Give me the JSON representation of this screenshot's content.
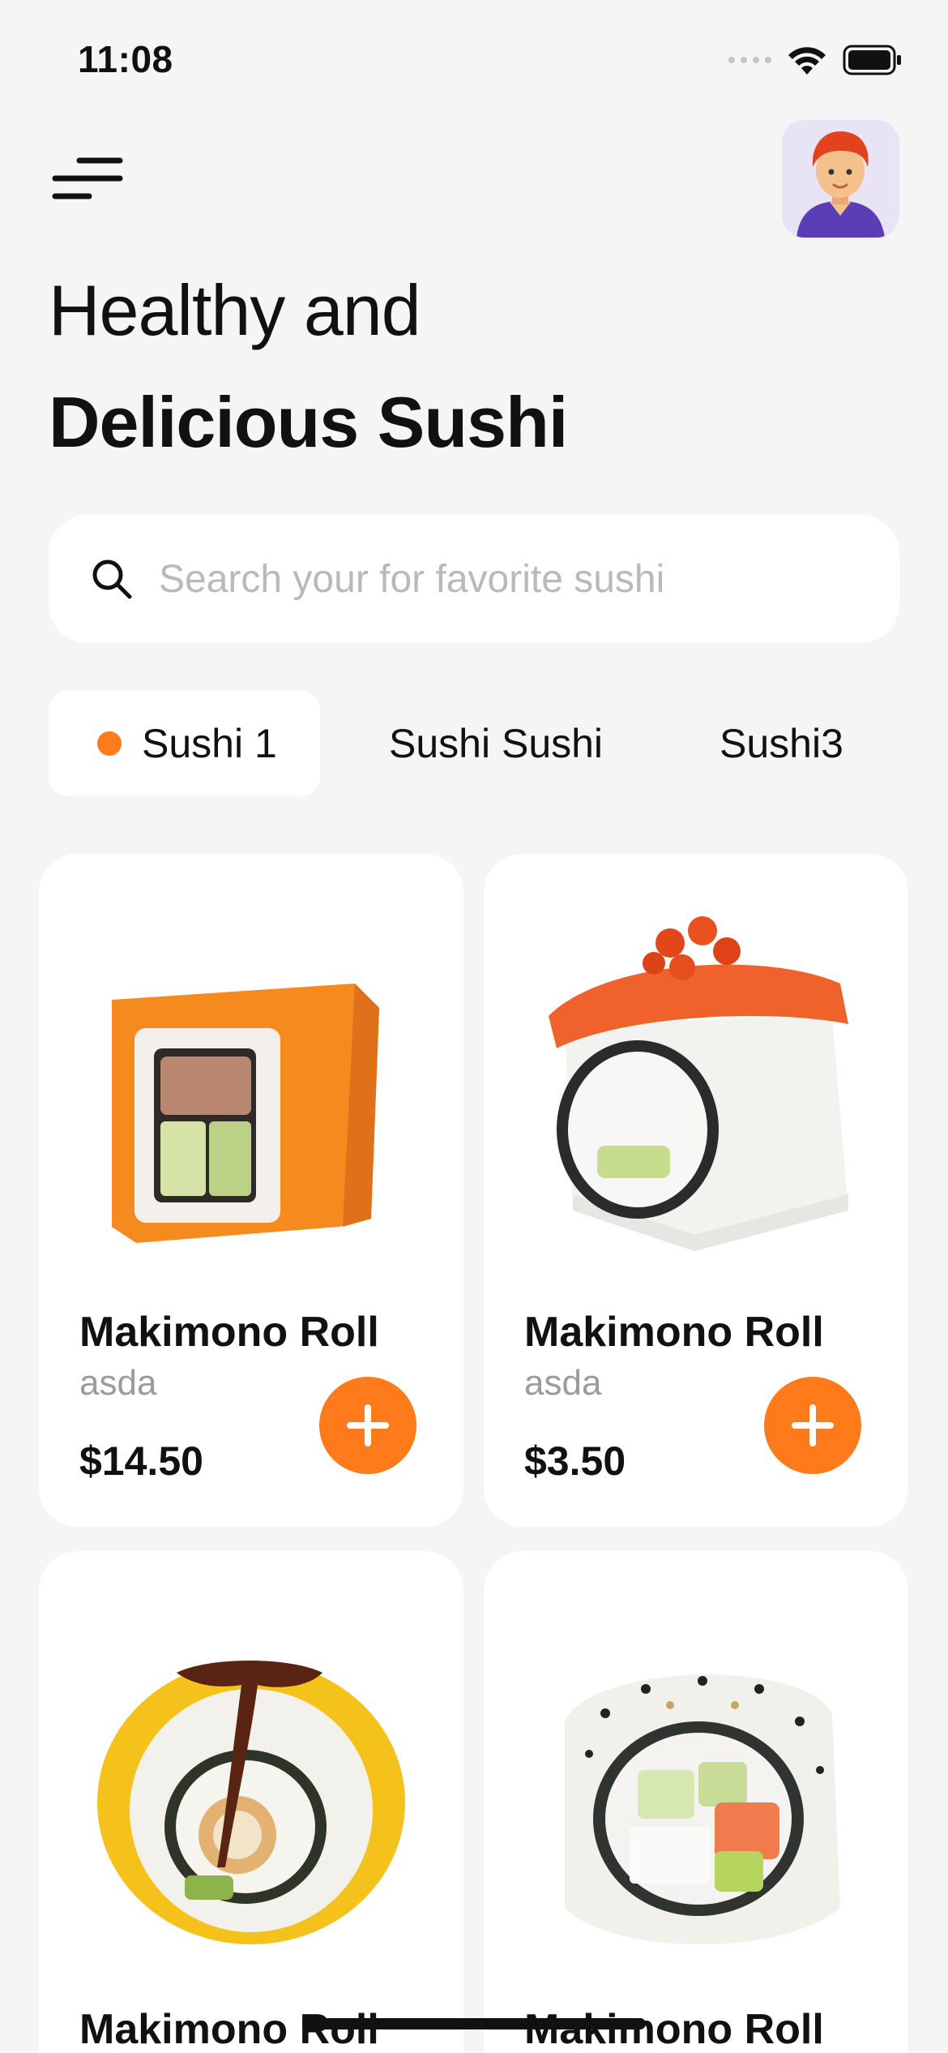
{
  "status_bar": {
    "time": "11:08"
  },
  "header": {
    "title_line1": "Healthy and",
    "title_line2": "Delicious Sushi"
  },
  "search": {
    "placeholder": "Search your for favorite sushi",
    "value": ""
  },
  "categories": [
    {
      "label": "Sushi 1",
      "active": true
    },
    {
      "label": "Sushi Sushi",
      "active": false
    },
    {
      "label": "Sushi3",
      "active": false
    }
  ],
  "products": [
    {
      "title": "Makimono Roll",
      "subtitle": "asda",
      "price": "$14.50",
      "image": "sushi-roll-tobiko"
    },
    {
      "title": "Makimono Roll",
      "subtitle": "asda",
      "price": "$3.50",
      "image": "sushi-roll-salmon-ikura"
    },
    {
      "title": "Makimono Roll",
      "image": "sushi-roll-mango-unagi"
    },
    {
      "title": "Makimono Roll",
      "image": "sushi-roll-sesame"
    }
  ],
  "colors": {
    "accent": "#FF7A1A",
    "background": "#F5F5F5",
    "card": "#FFFFFF",
    "subtle_text": "#9B9B9B",
    "avatar_bg": "#E9E3F6"
  },
  "icons": {
    "menu": "menu-lines-icon",
    "search": "search-icon",
    "add": "plus-icon",
    "wifi": "wifi-icon",
    "battery": "battery-icon",
    "signal": "signal-icon"
  }
}
